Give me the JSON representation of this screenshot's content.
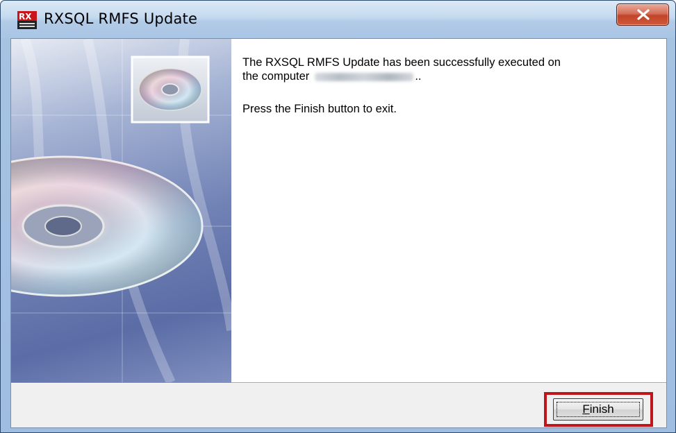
{
  "window": {
    "title": "RXSQL RMFS Update",
    "close_label": "x"
  },
  "message": {
    "line1": "The RXSQL RMFS Update has been successfully executed on",
    "line2_prefix": "the computer",
    "line2_suffix": "..",
    "instruction": "Press the Finish button to exit."
  },
  "buttons": {
    "finish_underlined": "F",
    "finish_rest": "inish"
  },
  "colors": {
    "highlight": "#c0161b",
    "close_red": "#c04429",
    "titlebar": "#b2cbe7"
  },
  "icons": {
    "app": "rx-app-icon",
    "banner_small": "cd-disc-icon",
    "banner_large": "cd-disc-icon",
    "close": "close-icon"
  }
}
